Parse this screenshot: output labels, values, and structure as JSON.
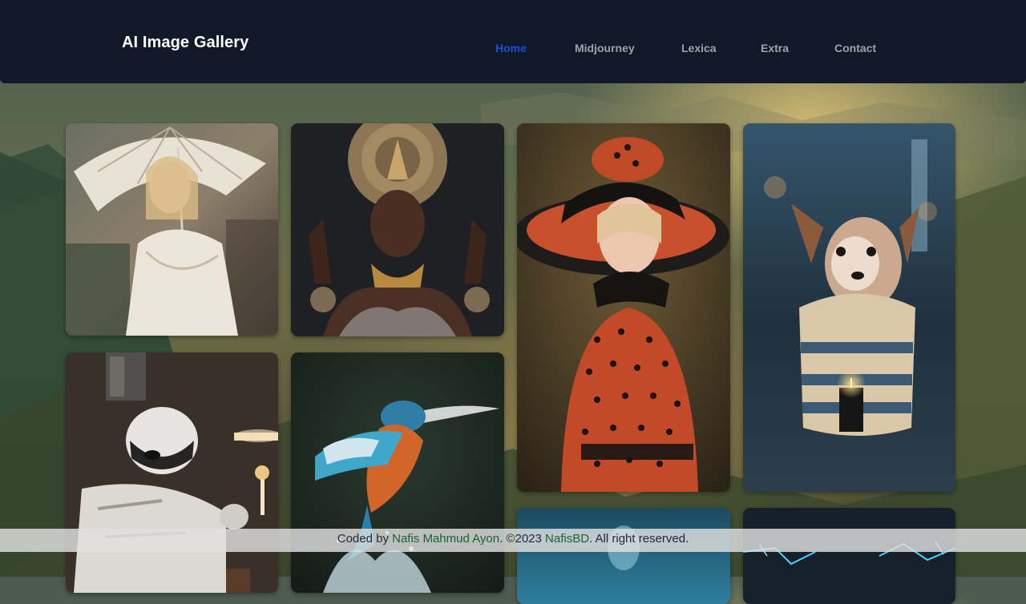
{
  "header": {
    "brand": "AI Image Gallery",
    "nav": [
      {
        "label": "Home",
        "active": true
      },
      {
        "label": "Midjourney",
        "active": false
      },
      {
        "label": "Lexica",
        "active": false
      },
      {
        "label": "Extra",
        "active": false
      },
      {
        "label": "Contact",
        "active": false
      }
    ]
  },
  "gallery": {
    "images": [
      {
        "subject": "woman-with-umbrella"
      },
      {
        "subject": "woman-golden-headdress"
      },
      {
        "subject": "woman-polka-dot-hat"
      },
      {
        "subject": "puppy-in-sweater"
      },
      {
        "subject": "stormtrooper-with-candle"
      },
      {
        "subject": "kingfisher-diving"
      },
      {
        "subject": "blue-scene-partial"
      },
      {
        "subject": "electric-scene-partial"
      }
    ]
  },
  "footer": {
    "prefix": "Coded by ",
    "author": "Nafis Mahmud Ayon",
    "middle": ". ©2023 ",
    "brand": "NafisBD",
    "suffix": ". All right reserved."
  },
  "colors": {
    "navbar_bg": "#111827",
    "nav_active": "#1d4ed8",
    "nav_inactive": "#9ca3af",
    "footer_link": "#166534"
  }
}
